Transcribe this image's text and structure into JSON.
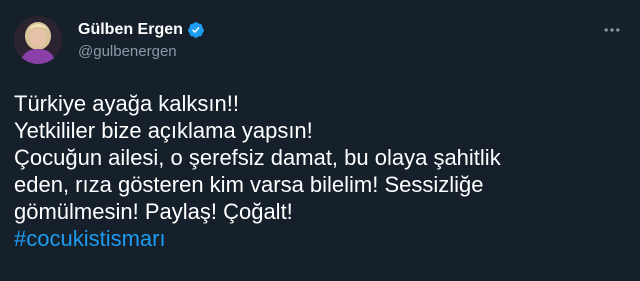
{
  "user": {
    "display_name": "Gülben Ergen",
    "handle": "@gulbenergen",
    "verified": true,
    "avatar_icon": "avatar-image"
  },
  "tweet": {
    "lines": [
      "Türkiye ayağa kalksın!!",
      "Yetkililer bize açıklama yapsın!",
      "Çocuğun ailesi, o şerefsiz damat, bu olaya şahitlik",
      "eden, rıza gösteren kim varsa bilelim! Sessizliğe",
      "gömülmesin! Paylaş! Çoğalt!"
    ],
    "hashtag": "#cocukistismarı"
  },
  "icons": {
    "more": "more-options-icon",
    "verified": "verified-badge-icon"
  },
  "colors": {
    "background": "#15202b",
    "text": "#ffffff",
    "secondary_text": "#8b98a5",
    "accent": "#1d9bf0"
  }
}
